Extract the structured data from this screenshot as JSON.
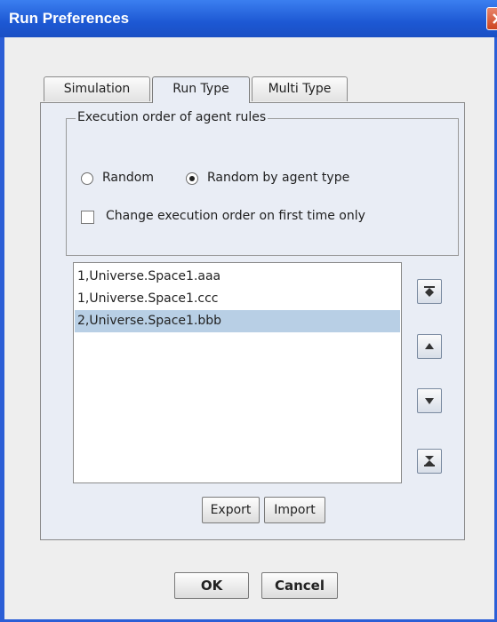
{
  "window": {
    "title": "Run Preferences"
  },
  "tabs": [
    {
      "label": "Simulation"
    },
    {
      "label": "Run Type"
    },
    {
      "label": "Multi Type"
    }
  ],
  "active_tab": "Run Type",
  "execution_order": {
    "legend": "Execution order of agent rules",
    "options": [
      {
        "label": "Random",
        "selected": false
      },
      {
        "label": "Random by agent type",
        "selected": true
      }
    ],
    "first_time_only": {
      "label": "Change execution order on first time only",
      "checked": false
    }
  },
  "rules_list": {
    "items": [
      {
        "text": "1,Universe.Space1.aaa",
        "selected": false
      },
      {
        "text": "1,Universe.Space1.ccc",
        "selected": false
      },
      {
        "text": "2,Universe.Space1.bbb",
        "selected": true
      }
    ]
  },
  "order_buttons": [
    {
      "icon": "move-to-top-icon"
    },
    {
      "icon": "move-up-icon"
    },
    {
      "icon": "move-down-icon"
    },
    {
      "icon": "move-to-bottom-icon"
    }
  ],
  "panel_buttons": {
    "export_label": "Export",
    "import_label": "Import"
  },
  "dialog_buttons": {
    "ok_label": "OK",
    "cancel_label": "Cancel"
  }
}
